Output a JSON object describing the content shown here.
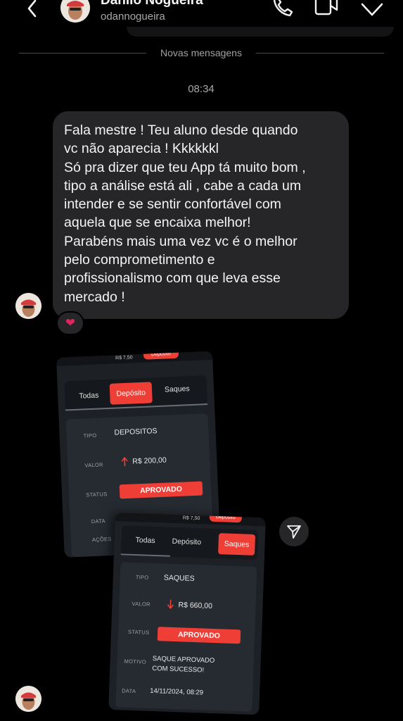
{
  "header": {
    "contact_name": "Danilo Nogueira",
    "username": "odannogueira"
  },
  "divider": {
    "label": "Novas mensagens"
  },
  "timestamp": "08:34",
  "message": {
    "lines": [
      "Fala mestre ! Teu aluno desde quando",
      "vc não aparecia ! Kkkkkkl",
      "Só pra dizer que teu App tá muito bom ,",
      "tipo a análise está ali , cabe a cada um",
      "intender e se sentir confortável com",
      "aquela que se encaixa melhor!",
      "Parabéns mais uma vez vc é o melhor",
      "pelo comprometimento e",
      "profissionalismo com que leva esse",
      "mercado !"
    ],
    "reaction": "❤"
  },
  "screenshot1": {
    "top_value": "R$ 7,50",
    "top_chip": "Depósito",
    "tabs": [
      "Todas",
      "Depósito",
      "Saques"
    ],
    "active_tab": "Depósito",
    "fields": {
      "tipo_label": "TIPO",
      "tipo_value": "DEPOSITOS",
      "valor_label": "VALOR",
      "valor_value": "R$ 200,00",
      "status_label": "STATUS",
      "status_value": "APROVADO",
      "data_label": "DATA",
      "acoes_label": "AÇÕES"
    }
  },
  "screenshot2": {
    "top_value": "R$ 7,50",
    "top_chip": "Depósito",
    "tabs": [
      "Todas",
      "Depósito",
      "Saques"
    ],
    "active_tab": "Saques",
    "fields": {
      "tipo_label": "TIPO",
      "tipo_value": "SAQUES",
      "valor_label": "VALOR",
      "valor_value": "R$ 660,00",
      "status_label": "STATUS",
      "status_value": "APROVADO",
      "motivo_label": "MOTIVO",
      "motivo_line1": "SAQUE APROVADO",
      "motivo_line2": "COM SUCESSO!",
      "data_label": "DATA",
      "data_value": "14/11/2024, 08:29"
    }
  },
  "colors": {
    "background": "#000000",
    "bubble": "#262628",
    "accent_red": "#ef3e36",
    "muted_text": "#a8a8a8"
  },
  "icons": [
    "back-arrow-icon",
    "phone-icon",
    "video-camera-icon",
    "info-icon",
    "heart-icon",
    "share-send-icon",
    "arrow-up-icon",
    "arrow-down-icon"
  ]
}
